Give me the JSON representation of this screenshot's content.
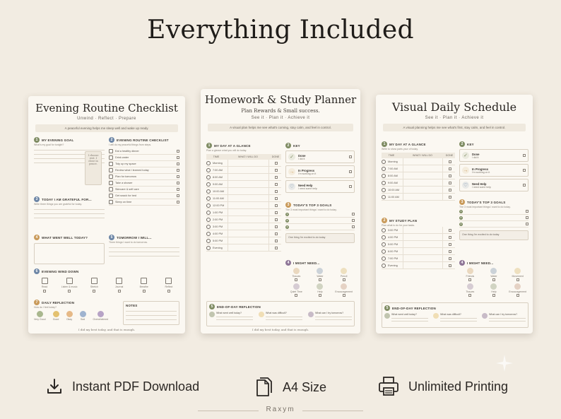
{
  "headline": "Everything Included",
  "sheets": [
    {
      "title": "Evening Routine Checklist",
      "sub2": "Unwind · Reflect · Prepare",
      "band": "A peaceful evening helps me sleep well and wake up ready.",
      "s1_label": "MY EVENING GOAL",
      "s1_note": "What's my goal for tonight?",
      "quote": "I choose rest. I close in peace.",
      "s2_label": "EVENING ROUTINE CHECKLIST",
      "s2_note": "I will do my peaceful things from steps.",
      "checklist": [
        "Eat a healthy dinner",
        "Drink water",
        "Tidy up my space",
        "Review what I learned today",
        "Plan for tomorrow",
        "Take a shower",
        "Skincare & self care",
        "Get snack for bed",
        "Sleep on time"
      ],
      "s3_label": "TODAY I AM GRATEFUL FOR...",
      "s3_note": "Write three things you are grateful for today.",
      "s4_label": "WHAT WENT WELL TODAY?",
      "s4_note": "Write something good that happened.",
      "s5_label": "TOMORROW I WILL...",
      "s5_note": "Three things I want to do tomorrow.",
      "s6_label": "EVENING WIND DOWN",
      "winddown": [
        "Read",
        "Listen & music",
        "Stretch",
        "Journal",
        "Breathe",
        "Reflect"
      ],
      "s7_label": "DAILY REFLECTION",
      "s7_note": "How do I feel today?",
      "moods": [
        "Very Good",
        "Good",
        "Okay",
        "Sad",
        "Overwhelmed"
      ],
      "notes_label": "NOTES",
      "foot": "I did my best today, and that is enough."
    },
    {
      "title": "Homework & Study Planner",
      "sub": "Plan Rewards & Small success.",
      "sub2": "See it · Plan it · Achieve it",
      "band": "A visual plan helps me see what's coming, stay calm, and feel in control.",
      "s1_label": "MY DAY AT A GLANCE",
      "s1_note": "Plan a glance what you will do today.",
      "cols": [
        "TIME",
        "WHAT I WILL DO",
        "DONE"
      ],
      "times": [
        "Morning",
        "7:00 AM",
        "8:00 AM",
        "9:00 AM",
        "10:00 AM",
        "11:00 AM",
        "12:00 PM",
        "1:00 PM",
        "2:00 PM",
        "3:00 PM",
        "4:00 PM",
        "5:00 PM",
        "Evening"
      ],
      "key_label": "KEY",
      "key_items": [
        [
          "Done",
          "I did it"
        ],
        [
          "In Progress",
          "I'm working on it"
        ],
        [
          "Need Help",
          "I need some help"
        ]
      ],
      "s3_label": "TODAY'S TOP 3 GOALS",
      "s3_note": "The 3 most important things I want to do today.",
      "pill": "One thing I'm excited to do today",
      "s4_label": "I MIGHT NEED...",
      "need_items": [
        "Tissues",
        "Water",
        "Pencil",
        "Quiet Time",
        "Help",
        "Encouragement"
      ],
      "s5_label": "END-OF-DAY REFLECTION",
      "reflect": [
        "What went well today?",
        "What was difficult?",
        "What can I try tomorrow?"
      ],
      "foot": "I did my best today, and that is enough."
    },
    {
      "title": "Visual Daily Schedule",
      "sub2": "See it · Plan it · Achieve it",
      "band": "A visual planning helps me see what's first, stay calm, and feel in control.",
      "s1_label": "MY DAY AT A GLANCE",
      "s1_note": "Write to show parts your of today.",
      "cols": [
        "TIME",
        "WHAT I WILL DO",
        "DONE"
      ],
      "times": [
        "Morning",
        "7:00 AM",
        "8:00 AM",
        "9:00 AM",
        "10:00 AM",
        "11:00 AM"
      ],
      "study_label": "MY STUDY PLAN",
      "study_note": "Plan what to do for your tasks.",
      "study_times": [
        "3:00 PM",
        "4:00 PM",
        "5:00 PM",
        "6:00 PM",
        "7:00 PM",
        "Evening"
      ],
      "key_label": "KEY",
      "key_items": [
        [
          "Done",
          "I did it"
        ],
        [
          "In Progress",
          "I'm working on it"
        ],
        [
          "Need Help",
          "I need some help"
        ]
      ],
      "s3_label": "TODAY'S TOP 3 GOALS",
      "s3_note": "The 3 most important things I want to do today.",
      "pill": "One thing I'm excited to do today",
      "s4_label": "I MIGHT NEED...",
      "need_items": [
        "Friends",
        "Water",
        "Movement",
        "Tissues",
        "Help",
        "Encouragement"
      ],
      "s5_label": "END-OF-DAY REFLECTION",
      "reflect": [
        "What went well today?",
        "What was difficult?",
        "What can I try tomorrow?"
      ]
    }
  ],
  "features": {
    "download": "Instant PDF Download",
    "size": "A4 Size",
    "printing": "Unlimited Printing"
  },
  "brand": "Raxym",
  "colors": {
    "background": "#f2ece2",
    "sheet": "#fbf8f2",
    "green": "#7f8c63",
    "orange": "#c99a5a",
    "blue": "#6d86a6"
  }
}
